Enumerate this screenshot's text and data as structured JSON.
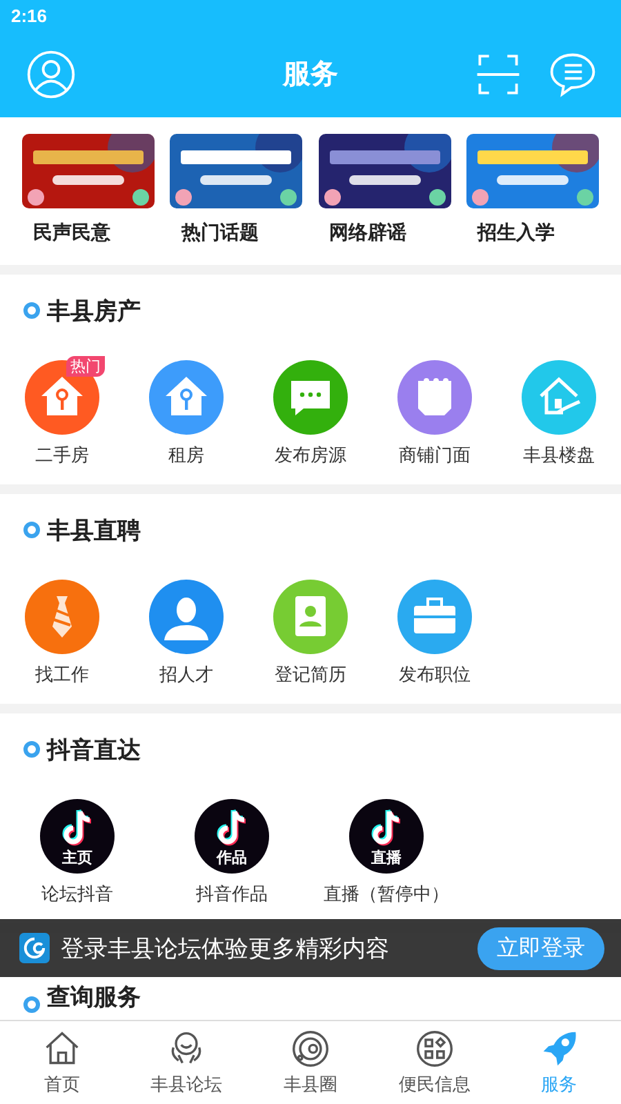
{
  "status_bar": {
    "time": "2:16"
  },
  "header": {
    "title": "服务"
  },
  "banners": [
    {
      "label": "民声民意"
    },
    {
      "label": "热门话题"
    },
    {
      "label": "网络辟谣"
    },
    {
      "label": "招生入学"
    }
  ],
  "sections": [
    {
      "title": "丰县房产",
      "items": [
        {
          "label": "二手房",
          "kind": "house-key",
          "color": "#ff5a22",
          "badge": "热门"
        },
        {
          "label": "租房",
          "kind": "house-key",
          "color": "#3d9cfb"
        },
        {
          "label": "发布房源",
          "kind": "chat",
          "color": "#33b00d"
        },
        {
          "label": "商铺门面",
          "kind": "shops",
          "color": "#9a7fee"
        },
        {
          "label": "丰县楼盘",
          "kind": "house-hand",
          "color": "#22c8ea"
        }
      ]
    },
    {
      "title": "丰县直聘",
      "items": [
        {
          "label": "找工作",
          "kind": "tie",
          "color": "#f7700e"
        },
        {
          "label": "招人才",
          "kind": "person",
          "color": "#1f8ff0"
        },
        {
          "label": "登记简历",
          "kind": "book",
          "color": "#77cc33"
        },
        {
          "label": "发布职位",
          "kind": "briefcase",
          "color": "#2aaaf0"
        }
      ]
    },
    {
      "title": "抖音直达",
      "items": [
        {
          "label": "论坛抖音",
          "kind": "tiktok",
          "color": "#0a0510",
          "caption": "主页"
        },
        {
          "label": "抖音作品",
          "kind": "tiktok",
          "color": "#0a0510",
          "caption": "作品"
        },
        {
          "label": "直播（暂停中）",
          "kind": "tiktok",
          "color": "#0a0510",
          "caption": "直播"
        }
      ]
    },
    {
      "title": "查询服务"
    }
  ],
  "login_bar": {
    "text": "登录丰县论坛体验更多精彩内容",
    "button": "立即登录"
  },
  "tabs": [
    {
      "label": "首页",
      "kind": "home",
      "selected": false
    },
    {
      "label": "丰县论坛",
      "kind": "forum",
      "selected": false
    },
    {
      "label": "丰县圈",
      "kind": "orbit",
      "selected": false
    },
    {
      "label": "便民信息",
      "kind": "grid",
      "selected": false
    },
    {
      "label": "服务",
      "kind": "rocket",
      "selected": true
    }
  ]
}
